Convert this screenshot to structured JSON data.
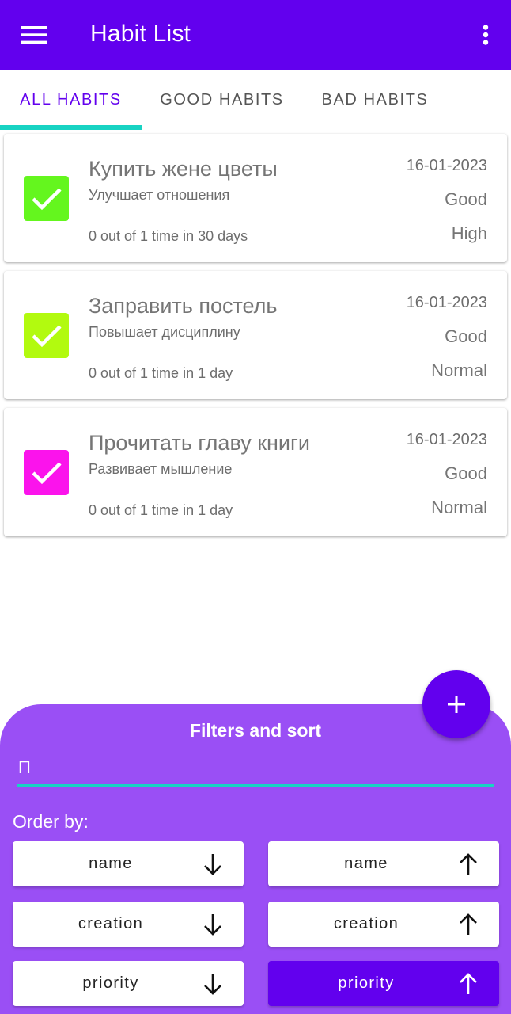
{
  "appbar": {
    "title": "Habit List",
    "menu_icon": "menu-icon",
    "overflow_icon": "more-vert-icon",
    "color": "#6200ee"
  },
  "tabs": [
    {
      "label": "ALL HABITS",
      "active": true
    },
    {
      "label": "GOOD HABITS",
      "active": false
    },
    {
      "label": "BAD HABITS",
      "active": false
    }
  ],
  "habits": [
    {
      "name": "Купить жене цветы",
      "description": "Улучшает отношения",
      "progress": "0 out of 1 time in 30 days",
      "date": "16-01-2023",
      "type": "Good",
      "priority": "High",
      "color": "#64f61e"
    },
    {
      "name": "Заправить постель",
      "description": "Повышает дисциплину",
      "progress": "0 out of 1 time in 1 day",
      "date": "16-01-2023",
      "type": "Good",
      "priority": "Normal",
      "color": "#b2fa0f"
    },
    {
      "name": "Прочитать главу книги",
      "description": "Развивает мышление",
      "progress": "0 out of 1 time in 1 day",
      "date": "16-01-2023",
      "type": "Good",
      "priority": "Normal",
      "color": "#fb13ec"
    }
  ],
  "filters": {
    "title": "Filters and sort",
    "search_value": "П",
    "order_label": "Order by:",
    "sort_buttons": [
      {
        "label": "name",
        "direction": "down",
        "selected": false
      },
      {
        "label": "name",
        "direction": "up",
        "selected": false
      },
      {
        "label": "creation",
        "direction": "down",
        "selected": false
      },
      {
        "label": "creation",
        "direction": "up",
        "selected": false
      },
      {
        "label": "priority",
        "direction": "down",
        "selected": false
      },
      {
        "label": "priority",
        "direction": "up",
        "selected": true
      }
    ],
    "sheet_color": "#9a4ff5"
  },
  "fab": {
    "icon": "plus-icon"
  }
}
